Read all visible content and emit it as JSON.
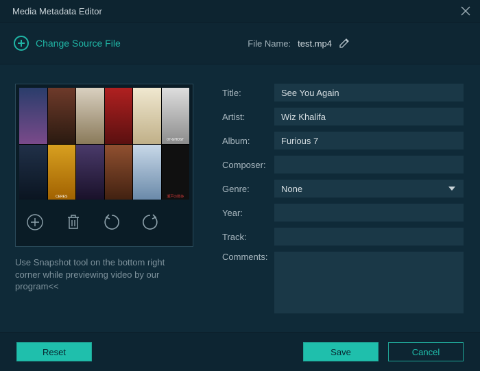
{
  "window": {
    "title": "Media Metadata Editor"
  },
  "source": {
    "change_label": "Change Source File",
    "filename_label": "File Name:",
    "filename": "test.mp4"
  },
  "hint": "Use Snapshot tool on the bottom right corner while previewing video by our program<<",
  "form": {
    "labels": {
      "title": "Title:",
      "artist": "Artist:",
      "album": "Album:",
      "composer": "Composer:",
      "genre": "Genre:",
      "year": "Year:",
      "track": "Track:",
      "comments": "Comments:"
    },
    "values": {
      "title": "See You Again",
      "artist": "Wiz Khalifa",
      "album": "Furious 7",
      "composer": "",
      "genre": "None",
      "year": "",
      "track": "",
      "comments": ""
    }
  },
  "posters": [
    "",
    "",
    "",
    "",
    "",
    "07-GHOST",
    "",
    "CERES",
    "",
    "",
    "",
    "瀬戸の戦争"
  ],
  "buttons": {
    "reset": "Reset",
    "save": "Save",
    "cancel": "Cancel"
  },
  "icons": {
    "close": "close-icon",
    "plus": "plus-circle-icon",
    "pencil": "pencil-icon",
    "add": "plus-circle-icon",
    "delete": "trash-icon",
    "undo": "undo-icon",
    "redo": "redo-icon",
    "chevron": "chevron-down-icon"
  }
}
